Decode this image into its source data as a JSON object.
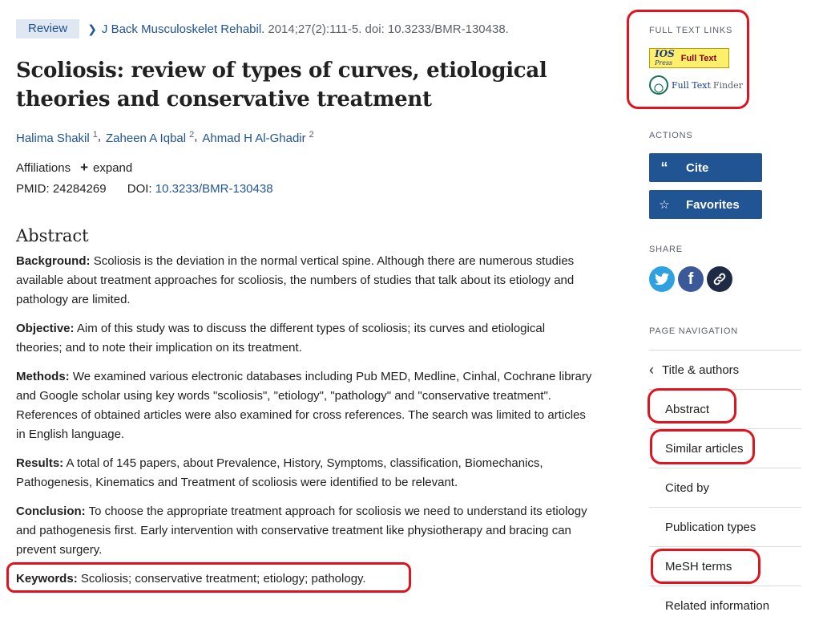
{
  "article": {
    "badge": "Review",
    "journal": "J Back Musculoskelet Rehabil.",
    "citation": "2014;27(2):111-5. doi: 10.3233/BMR-130438.",
    "title": "Scoliosis: review of types of curves, etiological theories and conservative treatment",
    "authors": [
      {
        "name": "Halima Shakil",
        "sup": "1"
      },
      {
        "name": "Zaheen A Iqbal",
        "sup": "2"
      },
      {
        "name": "Ahmad H Al-Ghadir",
        "sup": "2"
      }
    ],
    "affiliations_label": "Affiliations",
    "expand_label": "expand",
    "pmid_label": "PMID:",
    "pmid": "24284269",
    "doi_label": "DOI:",
    "doi": "10.3233/BMR-130438"
  },
  "abstract": {
    "heading": "Abstract",
    "sections": [
      {
        "label": "Background:",
        "text": "Scoliosis is the deviation in the normal vertical spine. Although there are numerous studies available about treatment approaches for scoliosis, the numbers of studies that talk about its etiology and pathology are limited."
      },
      {
        "label": "Objective:",
        "text": "Aim of this study was to discuss the different types of scoliosis; its curves and etiological theories; and to note their implication on its treatment."
      },
      {
        "label": "Methods:",
        "text": "We examined various electronic databases including Pub MED, Medline, Cinhal, Cochrane library and Google scholar using key words \"scoliosis\", \"etiology\", \"pathology\" and \"conservative treatment\". References of obtained articles were also examined for cross references. The search was limited to articles in English language."
      },
      {
        "label": "Results:",
        "text": "A total of 145 papers, about Prevalence, History, Symptoms, classification, Biomechanics, Pathogenesis, Kinematics and Treatment of scoliosis were identified to be relevant."
      },
      {
        "label": "Conclusion:",
        "text": "To choose the appropriate treatment approach for scoliosis we need to understand its etiology and pathogenesis first. Early intervention with conservative treatment like physiotherapy and bracing can prevent surgery."
      }
    ],
    "keywords_label": "Keywords:",
    "keywords": "Scoliosis; conservative treatment; etiology; pathology."
  },
  "sidebar": {
    "full_text_links_label": "FULL TEXT LINKS",
    "ios_logo_text": "IOS",
    "ios_logo_sub": "Press",
    "ios_full_text": "Full Text",
    "full_text_finder": "Full Text",
    "finder": "Finder",
    "actions_label": "ACTIONS",
    "cite_label": "Cite",
    "favorites_label": "Favorites",
    "share_label": "SHARE",
    "page_nav_label": "PAGE NAVIGATION",
    "nav_items": [
      "Title & authors",
      "Abstract",
      "Similar articles",
      "Cited by",
      "Publication types",
      "MeSH terms",
      "Related information"
    ]
  },
  "colors": {
    "link": "#205493",
    "button": "#205493",
    "annotation_red": "#e0141e"
  }
}
